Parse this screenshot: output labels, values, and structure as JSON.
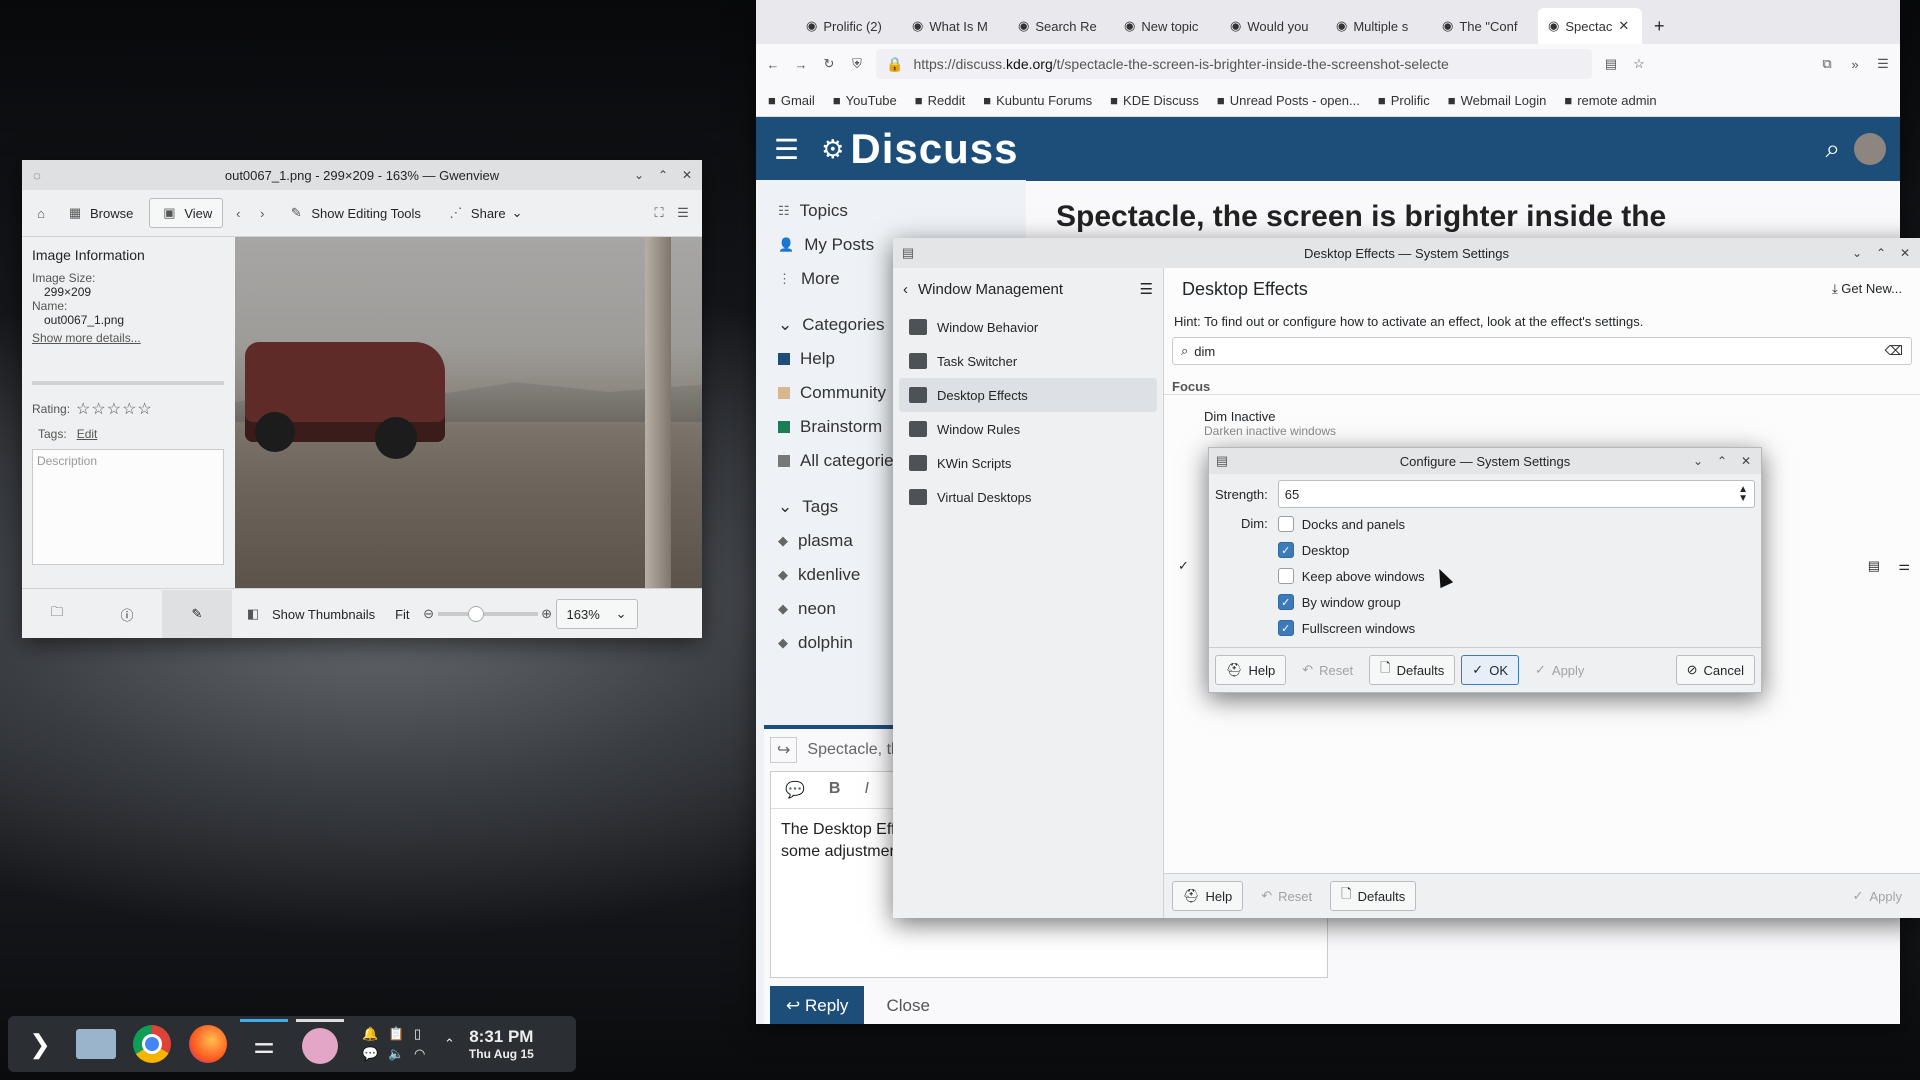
{
  "gwenview": {
    "title": "out0067_1.png - 299×209 - 163% — Gwenview",
    "toolbar": {
      "browse": "Browse",
      "view": "View",
      "editing_tools": "Show Editing Tools",
      "share": "Share"
    },
    "info": {
      "heading": "Image Information",
      "size_label": "Image Size:",
      "size_value": "299×209",
      "name_label": "Name:",
      "name_value": "out0067_1.png",
      "more_details": "Show more details...",
      "rating_label": "Rating:",
      "rating_stars": "☆☆☆☆☆",
      "tags_label": "Tags:",
      "tags_edit": "Edit",
      "description_placeholder": "Description"
    },
    "bottom": {
      "thumbnails": "Show Thumbnails",
      "fit": "Fit",
      "zoom": "163%"
    }
  },
  "firefox": {
    "tabs": [
      "Prolific (2)",
      "What Is M",
      "Search Re",
      "New topic",
      "Would you",
      "Multiple s",
      "The \"Conf",
      "Spectac"
    ],
    "url_prefix": "https://discuss.",
    "url_domain": "kde.org",
    "url_rest": "/t/spectacle-the-screen-is-brighter-inside-the-screenshot-selecte",
    "bookmarks": [
      "Gmail",
      "YouTube",
      "Reddit",
      "Kubuntu Forums",
      "KDE Discuss",
      "Unread Posts - open...",
      "Prolific",
      "Webmail Login",
      "remote admin"
    ]
  },
  "discuss": {
    "brand": "Discuss",
    "topic_title": "Spectacle, the screen is brighter inside the",
    "nav": [
      "Topics",
      "My Posts",
      "More"
    ],
    "categories_heading": "Categories",
    "categories": [
      "Help",
      "Community",
      "Brainstorm",
      "All categorie"
    ],
    "tags_heading": "Tags",
    "tags": [
      "plasma",
      "kdenlive",
      "neon",
      "dolphin"
    ],
    "composer": {
      "reply_title": "Spectacle, th",
      "body_line1": "The Desktop Eff",
      "body_line2": "some adjustmen",
      "reply_button": "Reply",
      "close_button": "Close"
    }
  },
  "system_settings": {
    "title": "Desktop Effects — System Settings",
    "back_label": "Window Management",
    "page_title": "Desktop Effects",
    "get_new": "Get New...",
    "hint": "Hint: To find out or configure how to activate an effect, look at the effect's settings.",
    "search_value": "dim",
    "section": "Focus",
    "effect_name": "Dim Inactive",
    "effect_desc": "Darken inactive windows",
    "nav_items": [
      "Window Behavior",
      "Task Switcher",
      "Desktop Effects",
      "Window Rules",
      "KWin Scripts",
      "Virtual Desktops"
    ],
    "footer": {
      "help": "Help",
      "reset": "Reset",
      "defaults": "Defaults",
      "apply": "Apply"
    }
  },
  "configure_dialog": {
    "title": "Configure — System Settings",
    "strength_label": "Strength:",
    "strength_value": "65",
    "dim_label": "Dim:",
    "options": [
      {
        "label": "Docks and panels",
        "checked": false
      },
      {
        "label": "Desktop",
        "checked": true
      },
      {
        "label": "Keep above windows",
        "checked": false
      },
      {
        "label": "By window group",
        "checked": true
      },
      {
        "label": "Fullscreen windows",
        "checked": true
      }
    ],
    "buttons": {
      "help": "Help",
      "reset": "Reset",
      "defaults": "Defaults",
      "ok": "OK",
      "apply": "Apply",
      "cancel": "Cancel"
    }
  },
  "taskbar": {
    "time": "8:31 PM",
    "date": "Thu Aug 15"
  },
  "colors": {
    "accent": "#3d7ab8",
    "discuss_header": "#1d4e7a",
    "taskbar": "#2b2e33"
  }
}
